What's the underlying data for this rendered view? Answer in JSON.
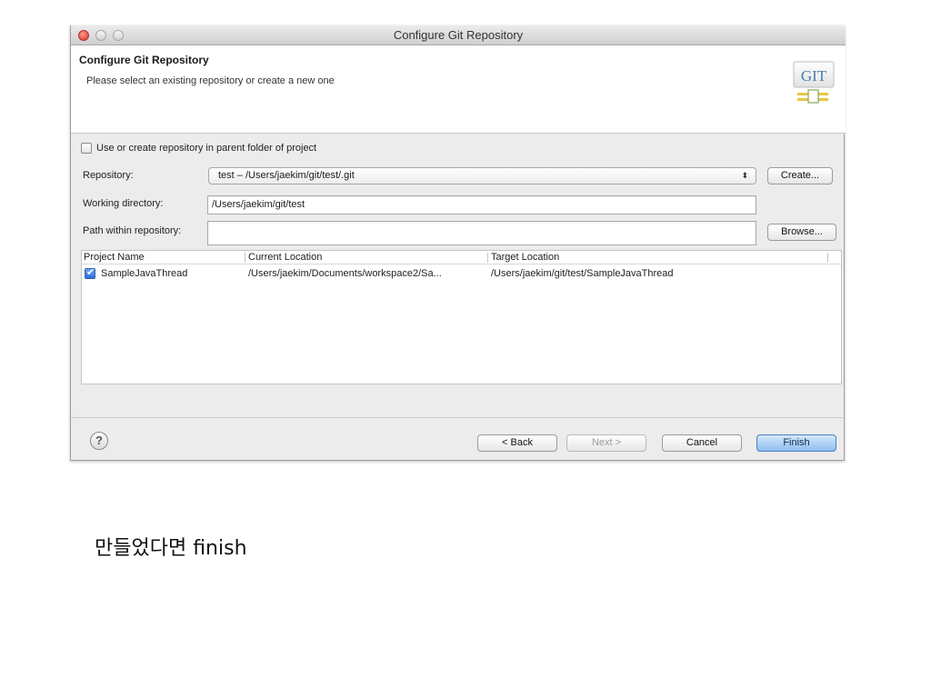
{
  "window": {
    "title": "Configure Git Repository"
  },
  "banner": {
    "title": "Configure Git Repository",
    "description": "Please select an existing repository or create a new one",
    "logo_text": "GIT",
    "logo_icon": "git-logo-icon"
  },
  "options": {
    "use_parent_label": "Use or create repository in parent folder of project",
    "use_parent_checked": false
  },
  "repository": {
    "label": "Repository:",
    "value": "test – /Users/jaekim/git/test/.git",
    "create_label": "Create..."
  },
  "working_directory": {
    "label": "Working directory:",
    "value": "/Users/jaekim/git/test"
  },
  "path_within": {
    "label": "Path within repository:",
    "value": "",
    "browse_label": "Browse..."
  },
  "projects_table": {
    "columns": [
      "Project Name",
      "Current Location",
      "Target Location"
    ],
    "rows": [
      {
        "checked": true,
        "name": "SampleJavaThread",
        "current": "/Users/jaekim/Documents/workspace2/Sa...",
        "target": "/Users/jaekim/git/test/SampleJavaThread"
      }
    ]
  },
  "buttons": {
    "help": "?",
    "back": "< Back",
    "next": "Next >",
    "cancel": "Cancel",
    "finish": "Finish"
  },
  "caption": "만들었다면 finish",
  "colors": {
    "window_bg": "#ececec",
    "default_button": "#8fbdf0",
    "close_button": "#d8302a"
  }
}
